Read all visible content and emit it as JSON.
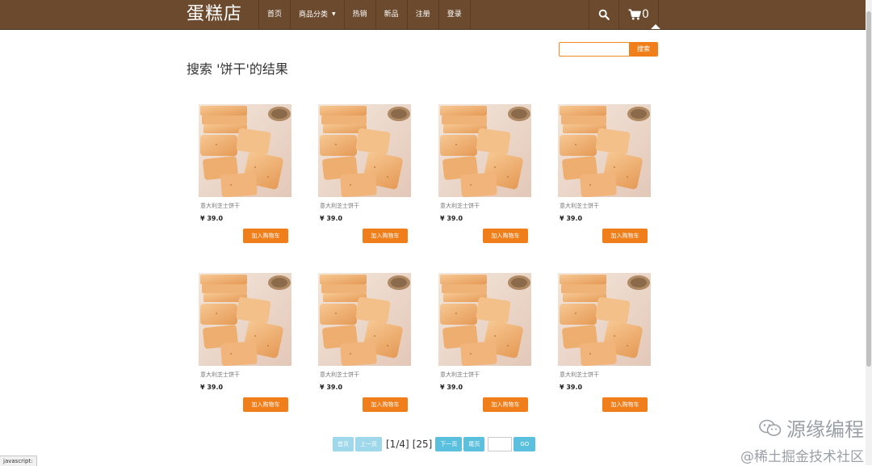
{
  "brand": "蛋糕店",
  "nav": {
    "items": [
      "首页",
      "商品分类",
      "热销",
      "新品",
      "注册",
      "登录"
    ],
    "cart_count": "0"
  },
  "search": {
    "value": "",
    "button": "搜索"
  },
  "page_title": "搜索 '饼干'的结果",
  "product_image_icon": "biscuit-photo",
  "products": [
    {
      "name": "意大利芝士饼干",
      "price": "¥ 39.0",
      "button": "加入购物车"
    },
    {
      "name": "意大利芝士饼干",
      "price": "¥ 39.0",
      "button": "加入购物车"
    },
    {
      "name": "意大利芝士饼干",
      "price": "¥ 39.0",
      "button": "加入购物车"
    },
    {
      "name": "意大利芝士饼干",
      "price": "¥ 39.0",
      "button": "加入购物车"
    },
    {
      "name": "意大利芝士饼干",
      "price": "¥ 39.0",
      "button": "加入购物车"
    },
    {
      "name": "意大利芝士饼干",
      "price": "¥ 39.0",
      "button": "加入购物车"
    },
    {
      "name": "意大利芝士饼干",
      "price": "¥ 39.0",
      "button": "加入购物车"
    },
    {
      "name": "意大利芝士饼干",
      "price": "¥ 39.0",
      "button": "加入购物车"
    }
  ],
  "pagination": {
    "first": "首页",
    "prev": "上一页",
    "status": "[1/4]",
    "total": "[25]",
    "next": "下一页",
    "last": "尾页",
    "go": "GO"
  },
  "watermark": {
    "line1": "源缘编程",
    "line2": "@稀土掘金技术社区"
  },
  "status_bar": "javascript:"
}
